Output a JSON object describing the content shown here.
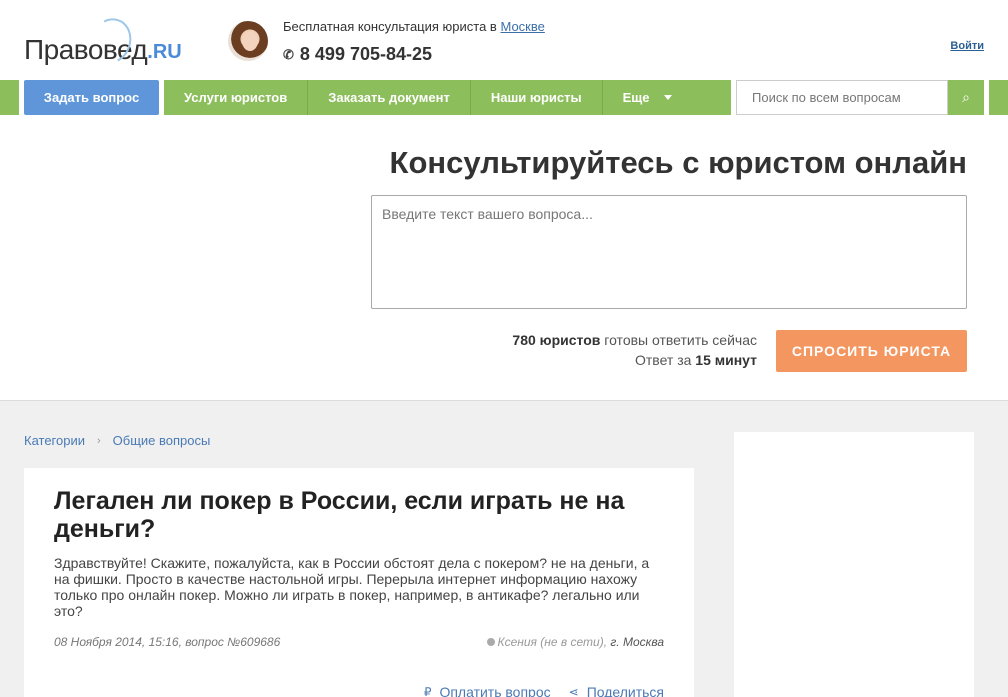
{
  "header": {
    "logo_text": "Правовед",
    "logo_suffix": ".RU",
    "consult_text": "Бесплатная консультация юриста в",
    "consult_city": "Москве",
    "phone": "8 499 705-84-25",
    "login": "Войти"
  },
  "nav": {
    "ask_question": "Задать вопрос",
    "items": [
      "Услуги юристов",
      "Заказать документ",
      "Наши юристы",
      "Еще"
    ],
    "search_placeholder": "Поиск по всем вопросам"
  },
  "hero": {
    "title": "Консультируйтесь с юристом онлайн",
    "textarea_placeholder": "Введите текст вашего вопроса...",
    "lawyers_count": "780 юристов",
    "lawyers_suffix": "готовы ответить сейчас",
    "answer_prefix": "Ответ за",
    "answer_time": "15 минут",
    "ask_button": "СПРОСИТЬ ЮРИСТА"
  },
  "breadcrumb": {
    "items": [
      "Категории",
      "Общие вопросы"
    ]
  },
  "question": {
    "title": "Легален ли покер в России, если играть не на деньги?",
    "text": "Здравствуйте! Скажите, пожалуйста, как в России обстоят дела с покером? не на деньги, а на фишки. Просто в качестве настольной игры. Перерыла интернет информацию нахожу только про онлайн покер. Можно ли играть в покер, например, в антикафе? легально или это?",
    "meta": "08 Ноября 2014, 15:16, вопрос №609686",
    "author": "Ксения (не в сети)",
    "city": "г. Москва",
    "pay_label": "Оплатить вопрос",
    "share_label": "Поделиться"
  },
  "colors": {
    "nav_green": "#8dbe5c",
    "ask_blue": "#5f96d9",
    "cta_orange": "#f4965f",
    "link_blue": "#4a7ab5"
  },
  "icons": [
    "phone-icon",
    "search-icon",
    "chevron-down-icon",
    "chevron-right-icon",
    "ruble-icon",
    "share-icon"
  ]
}
